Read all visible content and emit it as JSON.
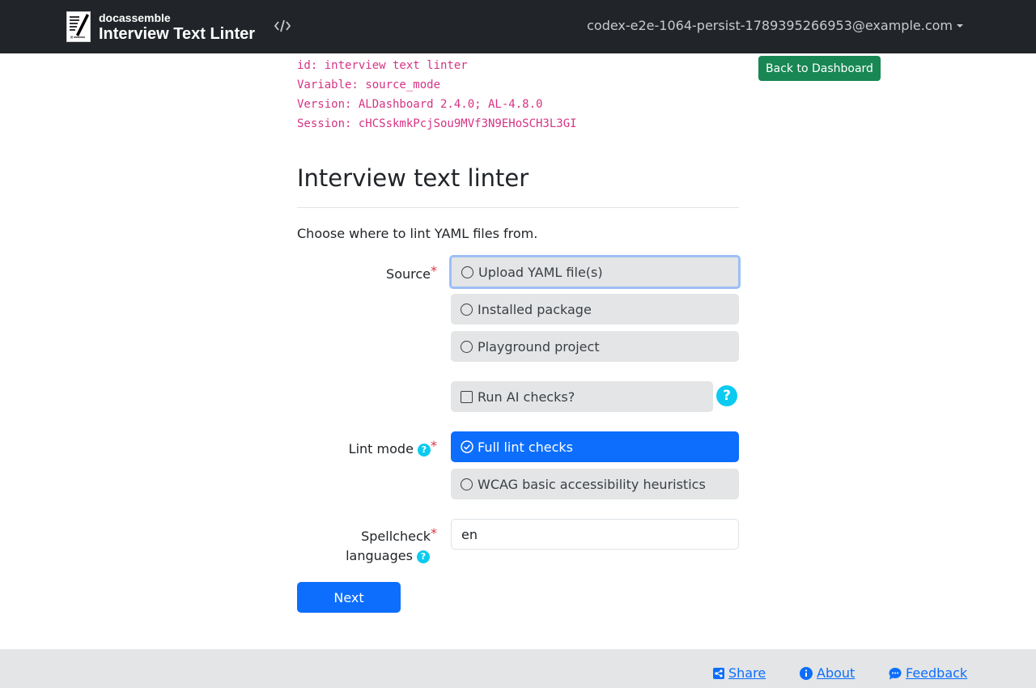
{
  "navbar": {
    "brand_small": "docassemble",
    "brand_title": "Interview Text Linter",
    "user_email": "codex-e2e-1064-persist-1789395266953@example.com"
  },
  "debug": {
    "id": "id: interview text linter",
    "variable": "Variable: source_mode",
    "version": "Version: ALDashboard 2.4.0; AL-4.8.0",
    "session": "Session: cHCSskmkPcjSou9MVf3N9EHoSCH3L3GI"
  },
  "back_button": "Back to Dashboard",
  "question": {
    "title": "Interview text linter",
    "subquestion": "Choose where to lint YAML files from."
  },
  "fields": {
    "source": {
      "label": "Source",
      "required_mark": "*",
      "options": [
        "Upload YAML file(s)",
        "Installed package",
        "Playground project"
      ]
    },
    "ai_checks": {
      "label": "Run AI checks?",
      "checked": false,
      "help": "?"
    },
    "lint_mode": {
      "label": "Lint mode",
      "required_mark": "*",
      "help": "?",
      "options": [
        "Full lint checks",
        "WCAG basic accessibility heuristics"
      ],
      "selected": "Full lint checks"
    },
    "spellcheck": {
      "label_line1": "Spellcheck",
      "label_line2": "languages",
      "required_mark": "*",
      "help": "?",
      "value": "en"
    }
  },
  "next_button": "Next",
  "footer": {
    "share": "Share",
    "about": "About",
    "feedback": "Feedback"
  },
  "colors": {
    "navbar_bg": "#212529",
    "primary": "#0d6efd",
    "success": "#198754",
    "info": "#0dcaf0",
    "danger": "#dc3545",
    "code": "#d63384"
  }
}
